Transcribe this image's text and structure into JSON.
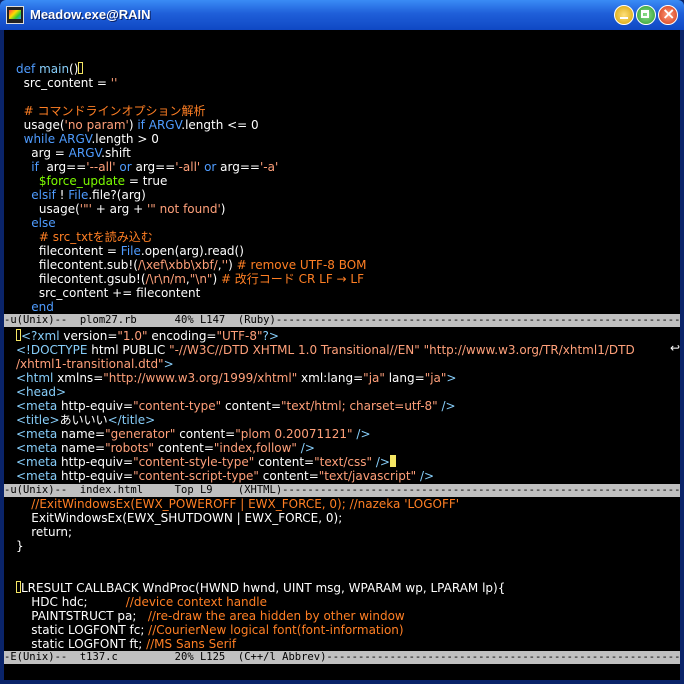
{
  "window": {
    "title": "Meadow.exe@RAIN"
  },
  "pane1": {
    "lines": [
      "",
      "def main()",
      "  src_content = ''",
      "",
      "  # コマンドラインオプション解析",
      "  usage('no param') if ARGV.length <= 0",
      "  while ARGV.length > 0",
      "    arg = ARGV.shift",
      "    if  arg=='--all' or arg=='-all' or arg=='-a'",
      "      $force_update = true",
      "    elsif ! File.file?(arg)",
      "      usage('\"' + arg + '\" not found')",
      "    else",
      "      # src_txtを読み込む",
      "      filecontent = File.open(arg).read()",
      "      filecontent.sub!(/\\xef\\xbb\\xbf/,'') # remove UTF-8 BOM",
      "      filecontent.gsub!(/\\r\\n/m,\"\\n\") # 改行コード CR LF → LF",
      "      src_content += filecontent",
      "    end"
    ],
    "modeline": "-u(Unix)--  plom27.rb      40% L147  (Ruby)----------------------------------------------------------------------"
  },
  "pane2": {
    "lines": [
      "<?xml version=\"1.0\" encoding=\"UTF-8\"?>",
      "<!DOCTYPE html PUBLIC \"-//W3C//DTD XHTML 1.0 Transitional//EN\" \"http://www.w3.org/TR/xhtml1/DTD",
      "/xhtml1-transitional.dtd\">",
      "<html xmlns=\"http://www.w3.org/1999/xhtml\" xml:lang=\"ja\" lang=\"ja\">",
      "<head>",
      "<meta http-equiv=\"content-type\" content=\"text/html; charset=utf-8\" />",
      "<title>あいいい</title>",
      "<meta name=\"generator\" content=\"plom 0.20071121\" />",
      "<meta name=\"robots\" content=\"index,follow\" />",
      "<meta http-equiv=\"content-style-type\" content=\"text/css\" />",
      "<meta http-equiv=\"content-script-type\" content=\"text/javascript\" />"
    ],
    "modeline": "-u(Unix)--  index.html     Top L9    (XHTML)------------------------------------------------------------------"
  },
  "pane3": {
    "lines": [
      "    //ExitWindowsEx(EWX_POWEROFF | EWX_FORCE, 0); //nazeka 'LOGOFF'",
      "    ExitWindowsEx(EWX_SHUTDOWN | EWX_FORCE, 0);",
      "    return;",
      "}",
      "",
      "",
      "LRESULT CALLBACK WndProc(HWND hwnd, UINT msg, WPARAM wp, LPARAM lp){",
      "    HDC hdc;          //device context handle",
      "    PAINTSTRUCT pa;   //re-draw the area hidden by other window",
      "    static LOGFONT fc; //CourierNew logical font(font-information)",
      "    static LOGFONT ft; //MS Sans Serif"
    ],
    "modeline": "-E(Unix)--  t137.c         20% L125  (C++/l Abbrev)--------------------------------------------------------------"
  },
  "colors": {
    "titlebar": "#1f5fd9",
    "background": "#000000",
    "modeline_active_bg": "#c0c0c0",
    "modeline_inactive_bg": "#c0c0c0",
    "keyword": "#4f9cff",
    "string": "#ffa07a",
    "comment": "#ff7f24",
    "constant": "#7cfc00",
    "cursor": "#f5e663"
  }
}
